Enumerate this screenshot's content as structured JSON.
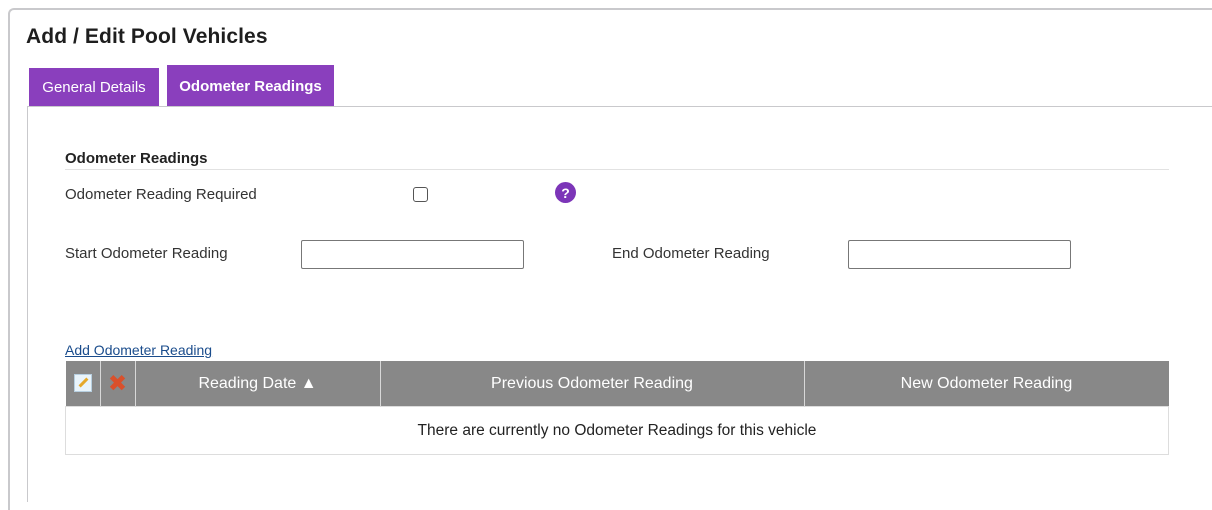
{
  "page": {
    "title": "Add / Edit Pool Vehicles"
  },
  "tabs": [
    {
      "label": "General Details",
      "active": false
    },
    {
      "label": "Odometer Readings",
      "active": true
    }
  ],
  "section": {
    "title": "Odometer Readings",
    "required_label": "Odometer Reading Required",
    "required_checked": false,
    "help_icon_glyph": "?",
    "start_label": "Start Odometer Reading",
    "start_value": "",
    "end_label": "End Odometer Reading",
    "end_value": ""
  },
  "grid": {
    "add_link": "Add Odometer Reading",
    "columns": [
      "Reading Date ▲",
      "Previous Odometer Reading",
      "New Odometer Reading"
    ],
    "empty_message": "There are currently no Odometer Readings for this vehicle",
    "icons": {
      "edit": "edit-icon",
      "delete": "delete-x-icon"
    }
  },
  "colors": {
    "tab_purple": "#8a3fbd",
    "help_purple": "#7c35b8",
    "header_gray": "#888888",
    "delete_red": "#d9502b",
    "link_blue": "#1a4c8c"
  }
}
